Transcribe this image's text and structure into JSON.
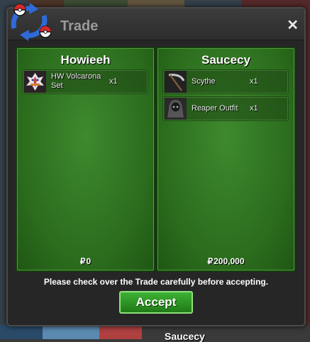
{
  "window": {
    "title": "Trade",
    "close_label": "✕"
  },
  "left_panel": {
    "trainer_name": "Howieeh",
    "currency_symbol": "₽",
    "money": "0",
    "items": [
      {
        "name": "HW Volcarona Set",
        "qty": "x1",
        "icon": "volcarona-costume-icon"
      }
    ]
  },
  "right_panel": {
    "trainer_name": "Saucecy",
    "currency_symbol": "₽",
    "money": "200,000",
    "items": [
      {
        "name": "Scythe",
        "qty": "x1",
        "icon": "scythe-icon"
      },
      {
        "name": "Reaper Outfit",
        "qty": "x1",
        "icon": "reaper-outfit-icon"
      }
    ]
  },
  "notice": "Please check over the Trade carefully before accepting.",
  "accept_label": "Accept",
  "background_name": "Saucecy",
  "colors": {
    "panel_green": "#2a6a1c",
    "accept_green": "#2f9a26",
    "window_bg": "#262626"
  }
}
